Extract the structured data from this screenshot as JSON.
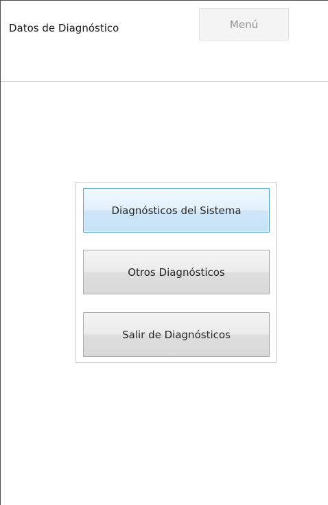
{
  "header": {
    "title": "Datos de Diagnóstico",
    "menu_label": "Menú"
  },
  "diagnostics_menu": {
    "items": [
      {
        "label": "Diagnósticos del Sistema",
        "selected": true
      },
      {
        "label": "Otros Diagnósticos",
        "selected": false
      },
      {
        "label": "Salir de Diagnósticos",
        "selected": false
      }
    ]
  },
  "colors": {
    "selected_border": "#5aa4d8",
    "selected_fill": "#e3f1fc",
    "button_fill": "#ececec",
    "menu_text": "#8f8f8f"
  }
}
